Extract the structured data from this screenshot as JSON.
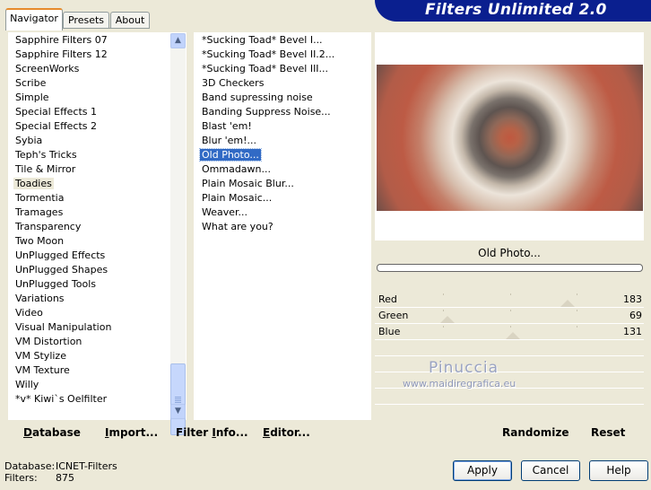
{
  "header": {
    "title": "Filters Unlimited 2.0"
  },
  "tabs": [
    {
      "label": "Navigator",
      "active": true
    },
    {
      "label": "Presets",
      "active": false
    },
    {
      "label": "About",
      "active": false
    }
  ],
  "categories": {
    "items": [
      "Sapphire Filters 07",
      "Sapphire Filters 12",
      "ScreenWorks",
      "Scribe",
      "Simple",
      "Special Effects 1",
      "Special Effects 2",
      "Sybia",
      "Teph's Tricks",
      "Tile & Mirror",
      "Toadies",
      "Tormentia",
      "Tramages",
      "Transparency",
      "Two Moon",
      "UnPlugged Effects",
      "UnPlugged Shapes",
      "UnPlugged Tools",
      "Variations",
      "Video",
      "Visual Manipulation",
      "VM Distortion",
      "VM Stylize",
      "VM Texture",
      "Willy",
      "*v* Kiwi`s Oelfilter"
    ],
    "selected": "Toadies"
  },
  "filters": {
    "items": [
      "*Sucking Toad*  Bevel I...",
      "*Sucking Toad*  Bevel II.2...",
      "*Sucking Toad*  Bevel III...",
      "3D Checkers",
      "Band supressing noise",
      "Banding Suppress Noise...",
      "Blast 'em!",
      "Blur 'em!...",
      "Old Photo...",
      "Ommadawn...",
      "Plain Mosaic Blur...",
      "Plain Mosaic...",
      "Weaver...",
      "What are you?"
    ],
    "selected": "Old Photo..."
  },
  "preview": {
    "filter_name": "Old Photo...",
    "progress": 0
  },
  "sliders": [
    {
      "label": "Red",
      "value": "183"
    },
    {
      "label": "Green",
      "value": "69"
    },
    {
      "label": "Blue",
      "value": "131"
    }
  ],
  "watermark": {
    "line1": "Pinuccia",
    "line2": "www.maidiregrafica.eu"
  },
  "toolbar": {
    "database_u": "D",
    "database_rest": "atabase",
    "import_u": "I",
    "import_rest": "mport...",
    "filterinfo_pre": "Filter ",
    "filterinfo_u": "I",
    "filterinfo_rest": "nfo...",
    "editor_u": "E",
    "editor_rest": "ditor...",
    "randomize": "Randomize",
    "reset": "Reset"
  },
  "status": {
    "database_label": "Database:",
    "database_value": "ICNET-Filters",
    "filters_label": "Filters:",
    "filters_value": "875"
  },
  "buttons": {
    "apply": "Apply",
    "cancel": "Cancel",
    "help": "Help"
  }
}
